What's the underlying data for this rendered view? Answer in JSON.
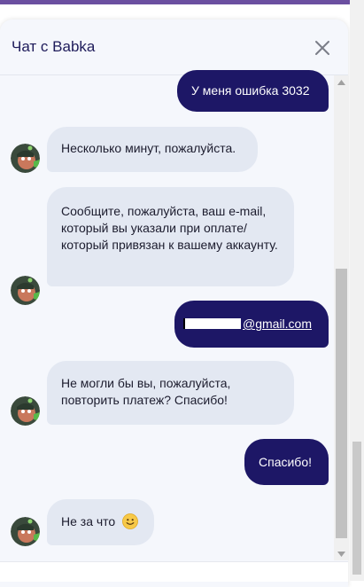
{
  "header": {
    "title": "Чат с Babka"
  },
  "messages": [
    {
      "side": "out",
      "text": "У меня ошибка 3032"
    },
    {
      "side": "in",
      "text": "Несколько минут, пожалуйста."
    },
    {
      "side": "in",
      "text": "Сообщите, пожалуйста, ваш e-mail, который вы указали при оплате/который привязан к вашему аккаунту."
    },
    {
      "side": "out",
      "text": "@gmail.com"
    },
    {
      "side": "in",
      "text": "Не могли бы вы, пожалуйста, повторить платеж? Спасибо!"
    },
    {
      "side": "out",
      "text": "Спасибо!"
    },
    {
      "side": "in",
      "text": "Не за что"
    }
  ],
  "icons": {
    "close": "close-icon",
    "emoji": "smiling-face-icon",
    "avatar": "agent-avatar"
  },
  "colors": {
    "outgoing_bubble": "#1d1766",
    "incoming_bubble": "#e3e8f2",
    "title": "#1e1b5a",
    "accent_bar": "#6b4fa0"
  }
}
